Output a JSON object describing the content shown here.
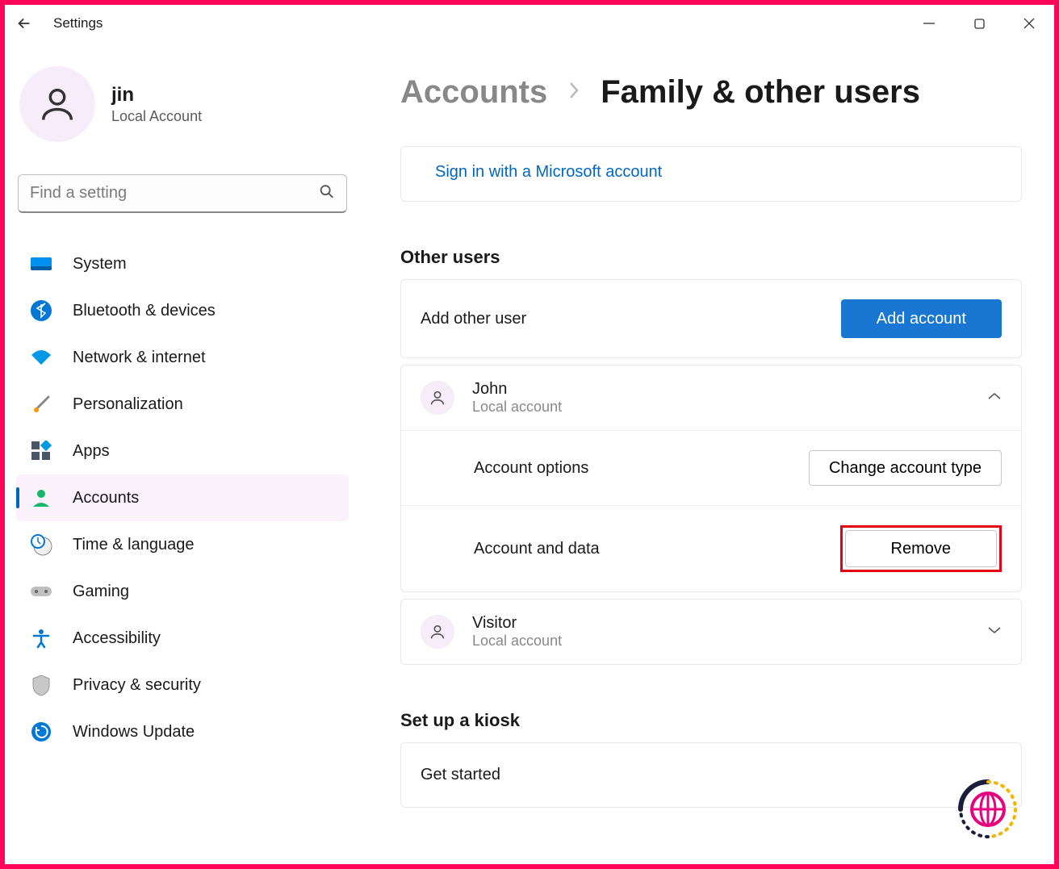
{
  "app": {
    "title": "Settings"
  },
  "profile": {
    "name": "jin",
    "type": "Local Account"
  },
  "search": {
    "placeholder": "Find a setting"
  },
  "nav": {
    "items": [
      {
        "label": "System"
      },
      {
        "label": "Bluetooth & devices"
      },
      {
        "label": "Network & internet"
      },
      {
        "label": "Personalization"
      },
      {
        "label": "Apps"
      },
      {
        "label": "Accounts"
      },
      {
        "label": "Time & language"
      },
      {
        "label": "Gaming"
      },
      {
        "label": "Accessibility"
      },
      {
        "label": "Privacy & security"
      },
      {
        "label": "Windows Update"
      }
    ]
  },
  "breadcrumb": {
    "parent": "Accounts",
    "current": "Family & other users"
  },
  "signin": {
    "link": "Sign in with a Microsoft account"
  },
  "other_users": {
    "title": "Other users",
    "add_label": "Add other user",
    "add_button": "Add account",
    "users": [
      {
        "name": "John",
        "type": "Local account"
      },
      {
        "name": "Visitor",
        "type": "Local account"
      }
    ],
    "account_options_label": "Account options",
    "change_type_button": "Change account type",
    "account_data_label": "Account and data",
    "remove_button": "Remove"
  },
  "kiosk": {
    "title": "Set up a kiosk",
    "label": "Get started"
  }
}
